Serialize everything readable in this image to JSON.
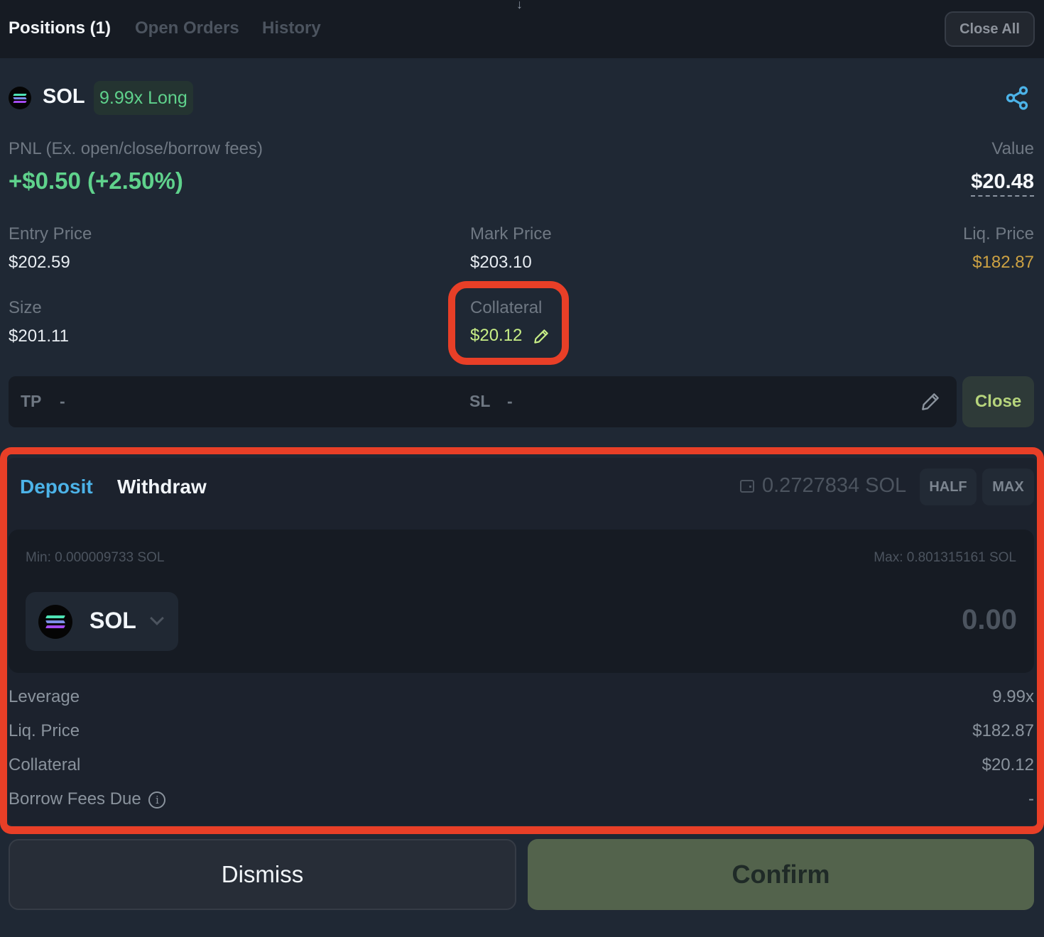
{
  "header": {
    "tabs": [
      {
        "label": "Positions (1)",
        "active": true
      },
      {
        "label": "Open Orders",
        "active": false
      },
      {
        "label": "History",
        "active": false
      }
    ],
    "close_all_label": "Close All",
    "arrow_glyph": "↓"
  },
  "position": {
    "symbol": "SOL",
    "badge": "9.99x Long",
    "pnl_label": "PNL (Ex. open/close/borrow fees)",
    "pnl_value": "+$0.50 (+2.50%)",
    "value_label": "Value",
    "value_amount": "$20.48",
    "entry_price_label": "Entry Price",
    "entry_price": "$202.59",
    "mark_price_label": "Mark Price",
    "mark_price": "$203.10",
    "liq_price_label": "Liq. Price",
    "liq_price": "$182.87",
    "size_label": "Size",
    "size": "$201.11",
    "collateral_label": "Collateral",
    "collateral": "$20.12",
    "tp_label": "TP",
    "tp_value": "-",
    "sl_label": "SL",
    "sl_value": "-",
    "close_label": "Close"
  },
  "collateral_panel": {
    "tabs": [
      {
        "label": "Deposit",
        "active": true
      },
      {
        "label": "Withdraw",
        "active": false
      }
    ],
    "wallet_balance": "0.2727834 SOL",
    "half_label": "HALF",
    "max_label": "MAX",
    "min_text": "Min: 0.000009733 SOL",
    "max_text": "Max: 0.801315161 SOL",
    "token": "SOL",
    "amount_placeholder": "0.00",
    "summary": [
      {
        "label": "Leverage",
        "value": "9.99x"
      },
      {
        "label": "Liq. Price",
        "value": "$182.87"
      },
      {
        "label": "Collateral",
        "value": "$20.12"
      },
      {
        "label": "Borrow Fees Due",
        "value": "-"
      }
    ],
    "info_glyph": "i"
  },
  "actions": {
    "dismiss_label": "Dismiss",
    "confirm_label": "Confirm"
  },
  "colors": {
    "accent_blue": "#4cb3e8",
    "positive_green": "#5fd28c",
    "warning_gold": "#cda243",
    "collateral_lime": "#c8ee86",
    "highlight_red": "#e83f27"
  }
}
